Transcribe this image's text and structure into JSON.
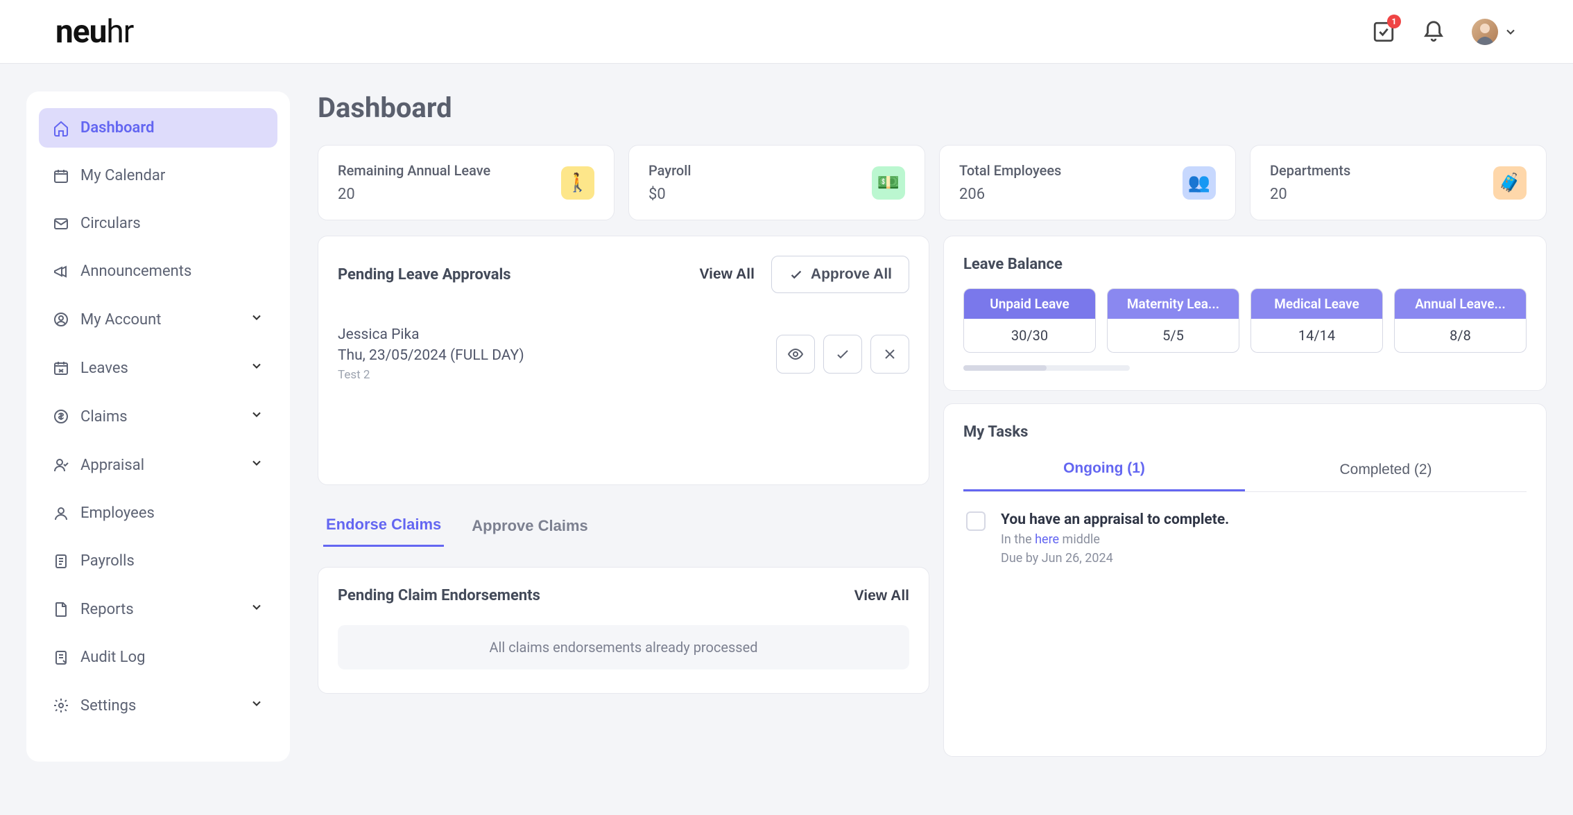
{
  "logo": {
    "a": "neu",
    "b": "hr"
  },
  "header": {
    "inbox_badge": "1"
  },
  "sidebar": {
    "items": [
      {
        "label": "Dashboard",
        "expandable": false
      },
      {
        "label": "My Calendar",
        "expandable": false
      },
      {
        "label": "Circulars",
        "expandable": false
      },
      {
        "label": "Announcements",
        "expandable": false
      },
      {
        "label": "My Account",
        "expandable": true
      },
      {
        "label": "Leaves",
        "expandable": true
      },
      {
        "label": "Claims",
        "expandable": true
      },
      {
        "label": "Appraisal",
        "expandable": true
      },
      {
        "label": "Employees",
        "expandable": false
      },
      {
        "label": "Payrolls",
        "expandable": false
      },
      {
        "label": "Reports",
        "expandable": true
      },
      {
        "label": "Audit Log",
        "expandable": false
      },
      {
        "label": "Settings",
        "expandable": true
      }
    ]
  },
  "page_title": "Dashboard",
  "stats": [
    {
      "label": "Remaining Annual Leave",
      "value": "20"
    },
    {
      "label": "Payroll",
      "value": "$0"
    },
    {
      "label": "Total Employees",
      "value": "206"
    },
    {
      "label": "Departments",
      "value": "20"
    }
  ],
  "pending_approvals": {
    "title": "Pending Leave Approvals",
    "view_all": "View All",
    "approve_all": "Approve All",
    "items": [
      {
        "name": "Jessica Pika",
        "date": "Thu, 23/05/2024 (FULL DAY)",
        "note": "Test 2"
      }
    ]
  },
  "claims_tabs": {
    "endorse": "Endorse Claims",
    "approve": "Approve Claims"
  },
  "pending_endorsements": {
    "title": "Pending Claim Endorsements",
    "view_all": "View All",
    "empty": "All claims endorsements already processed"
  },
  "leave_balance": {
    "title": "Leave Balance",
    "items": [
      {
        "label": "Unpaid Leave",
        "value": "30/30"
      },
      {
        "label": "Maternity Lea...",
        "value": "5/5"
      },
      {
        "label": "Medical Leave",
        "value": "14/14"
      },
      {
        "label": "Annual Leave...",
        "value": "8/8"
      }
    ]
  },
  "my_tasks": {
    "title": "My Tasks",
    "ongoing_label": "Ongoing (1)",
    "completed_label": "Completed (2)",
    "task": {
      "title": "You have an appraisal to complete.",
      "sub_pre": "In the ",
      "sub_link": "here",
      "sub_post": " middle",
      "due": "Due by Jun 26, 2024"
    }
  }
}
